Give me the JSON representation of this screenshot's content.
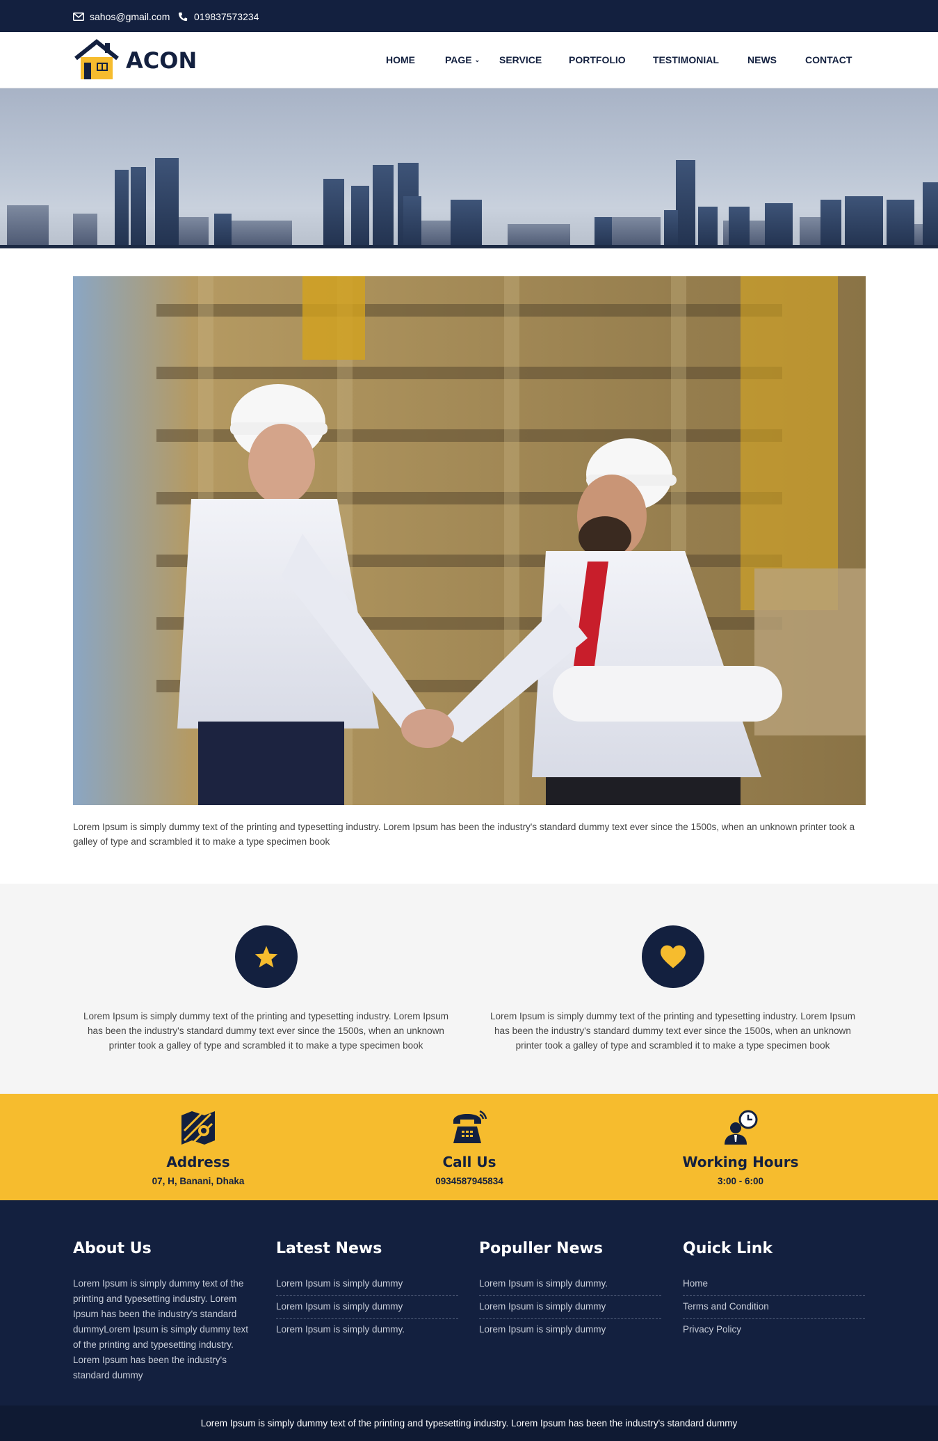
{
  "topbar": {
    "email": "sahos@gmail.com",
    "phone": "019837573234"
  },
  "brand": {
    "name": "ACON"
  },
  "nav": {
    "home": "HOME",
    "page": "PAGE",
    "service": "SERVICE",
    "portfolio": "PORTFOLIO",
    "testimonial": "TESTIMONIAL",
    "news": "NEWS",
    "contact": "CONTACT"
  },
  "intro": {
    "text": "Lorem Ipsum is simply dummy text of the printing and typesetting industry. Lorem Ipsum has been the industry's standard dummy text ever since the 1500s, when an unknown printer took a galley of type and scrambled it to make a type specimen book"
  },
  "features": [
    {
      "icon": "star-icon",
      "text": "Lorem Ipsum is simply dummy text of the printing and typesetting industry. Lorem Ipsum has been the industry's standard dummy text ever since the 1500s, when an unknown printer took a galley of type and scrambled it to make a type specimen book"
    },
    {
      "icon": "heart-icon",
      "text": "Lorem Ipsum is simply dummy text of the printing and typesetting industry. Lorem Ipsum has been the industry's standard dummy text ever since the 1500s, when an unknown printer took a galley of type and scrambled it to make a type specimen book"
    }
  ],
  "contact_info": [
    {
      "icon": "map-icon",
      "title": "Address",
      "value": "07, H, Banani, Dhaka"
    },
    {
      "icon": "phone-icon",
      "title": "Call Us",
      "value": "0934587945834"
    },
    {
      "icon": "clock-icon",
      "title": "Working Hours",
      "value": "3:00 - 6:00"
    }
  ],
  "footer": {
    "about": {
      "title": "About Us",
      "text": "Lorem Ipsum is simply dummy text of the printing and typesetting industry. Lorem Ipsum has been the industry's standard dummyLorem Ipsum is simply dummy text of the printing and typesetting industry. Lorem Ipsum has been the industry's standard dummy"
    },
    "latest_news": {
      "title": "Latest News",
      "items": [
        "Lorem Ipsum is simply dummy",
        "Lorem Ipsum is simply dummy",
        "Lorem Ipsum is simply dummy."
      ]
    },
    "popular_news": {
      "title": "Populler News",
      "items": [
        "Lorem Ipsum is simply dummy.",
        "Lorem Ipsum is simply dummy",
        "Lorem Ipsum is simply dummy"
      ]
    },
    "quick_link": {
      "title": "Quick Link",
      "items": [
        "Home",
        "Terms and Condition",
        "Privacy Policy"
      ]
    }
  },
  "copyright": "Lorem Ipsum is simply dummy text of the printing and typesetting industry. Lorem Ipsum has been the industry's standard dummy",
  "colors": {
    "navy": "#13203f",
    "accent": "#f6bc2e",
    "light_bg": "#f5f5f5"
  }
}
